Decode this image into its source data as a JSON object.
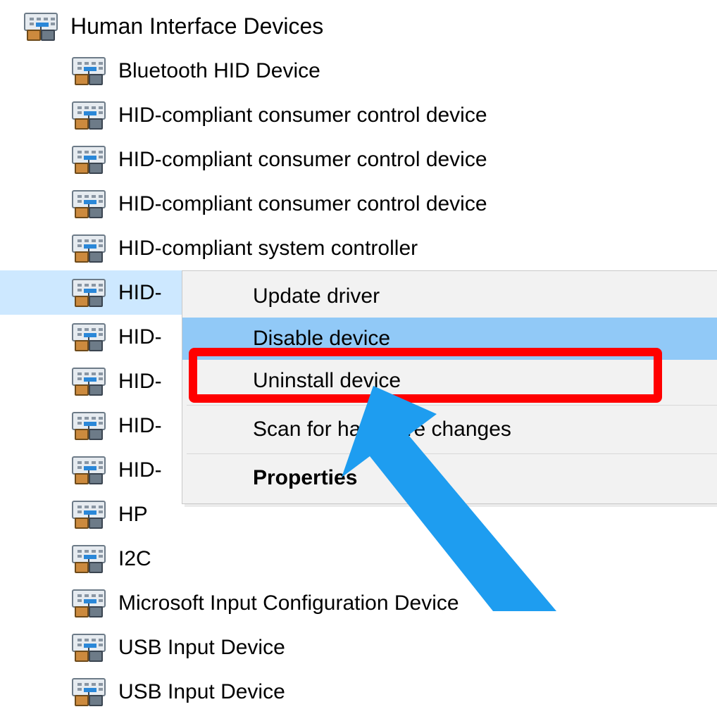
{
  "tree": {
    "parent_label": "Human Interface Devices",
    "children": [
      "Bluetooth HID Device",
      "HID-compliant consumer control device",
      "HID-compliant consumer control device",
      "HID-compliant consumer control device",
      "HID-compliant system controller",
      "HID-",
      "HID-",
      "HID-",
      "HID-",
      "HID-",
      "HP",
      "I2C",
      "Microsoft Input Configuration Device",
      "USB Input Device",
      "USB Input Device"
    ],
    "selected_index": 5
  },
  "context_menu": {
    "update": "Update driver",
    "disable": "Disable device",
    "uninstall": "Uninstall device",
    "scan": "Scan for hardware changes",
    "properties": "Properties",
    "hovered": "disable"
  },
  "annotations": {
    "highlight_target": "disable",
    "arrow_color": "#1e9df0",
    "highlight_color": "#ff0000"
  }
}
